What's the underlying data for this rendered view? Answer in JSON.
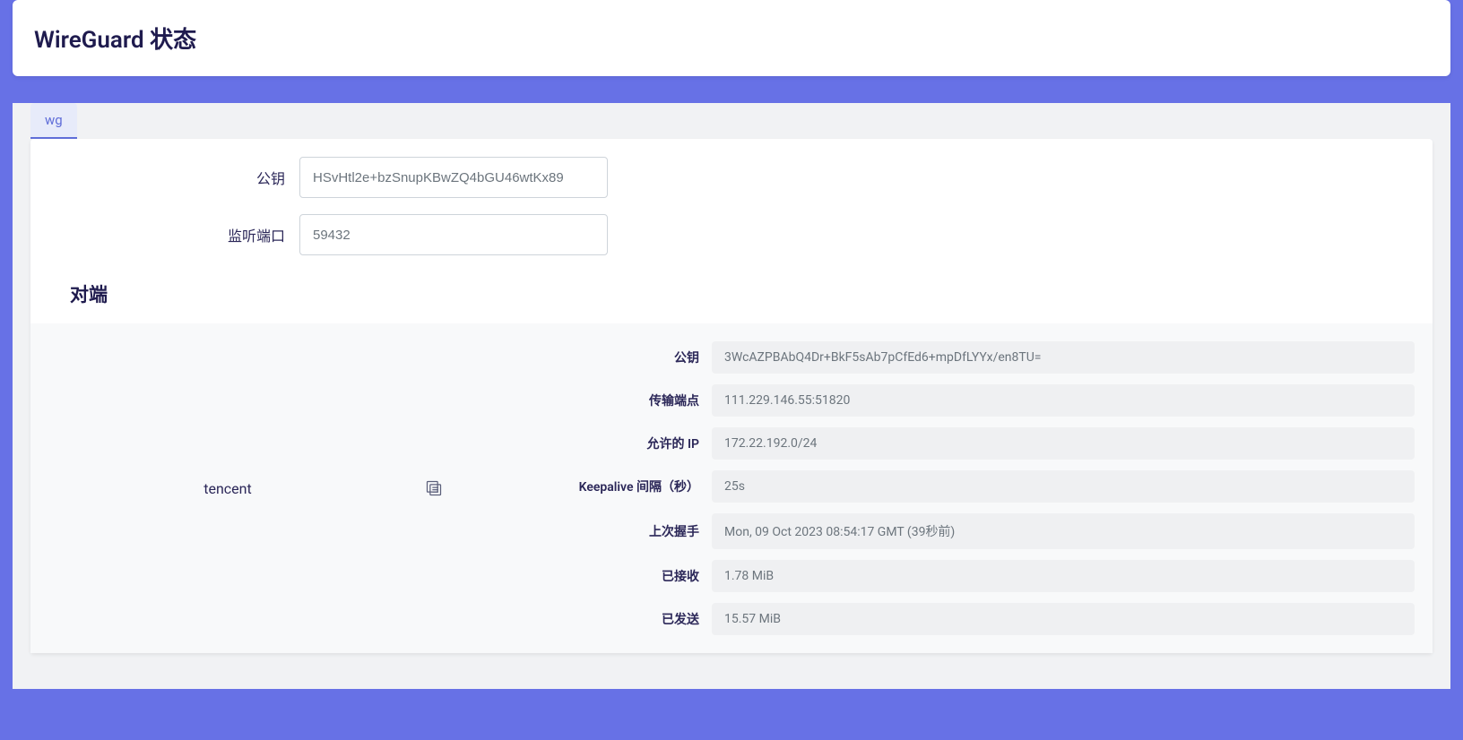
{
  "header": {
    "title": "WireGuard 状态"
  },
  "tabs": [
    {
      "label": "wg"
    }
  ],
  "interface": {
    "pubkey_label": "公钥",
    "pubkey_value": "HSvHtl2e+bzSnupKBwZQ4bGU46wtKx89",
    "port_label": "监听端口",
    "port_value": "59432"
  },
  "peers_heading": "对端",
  "peer": {
    "name": "tencent",
    "rows": [
      {
        "label": "公钥",
        "value": "3WcAZPBAbQ4Dr+BkF5sAb7pCfEd6+mpDfLYYx/en8TU="
      },
      {
        "label": "传输端点",
        "value": "111.229.146.55:51820"
      },
      {
        "label": "允许的 IP",
        "value": "172.22.192.0/24"
      },
      {
        "label": "Keepalive 间隔（秒）",
        "value": "25s"
      },
      {
        "label": "上次握手",
        "value": "Mon, 09 Oct 2023 08:54:17 GMT (39秒前)"
      },
      {
        "label": "已接收",
        "value": "1.78 MiB"
      },
      {
        "label": "已发送",
        "value": "15.57 MiB"
      }
    ]
  }
}
